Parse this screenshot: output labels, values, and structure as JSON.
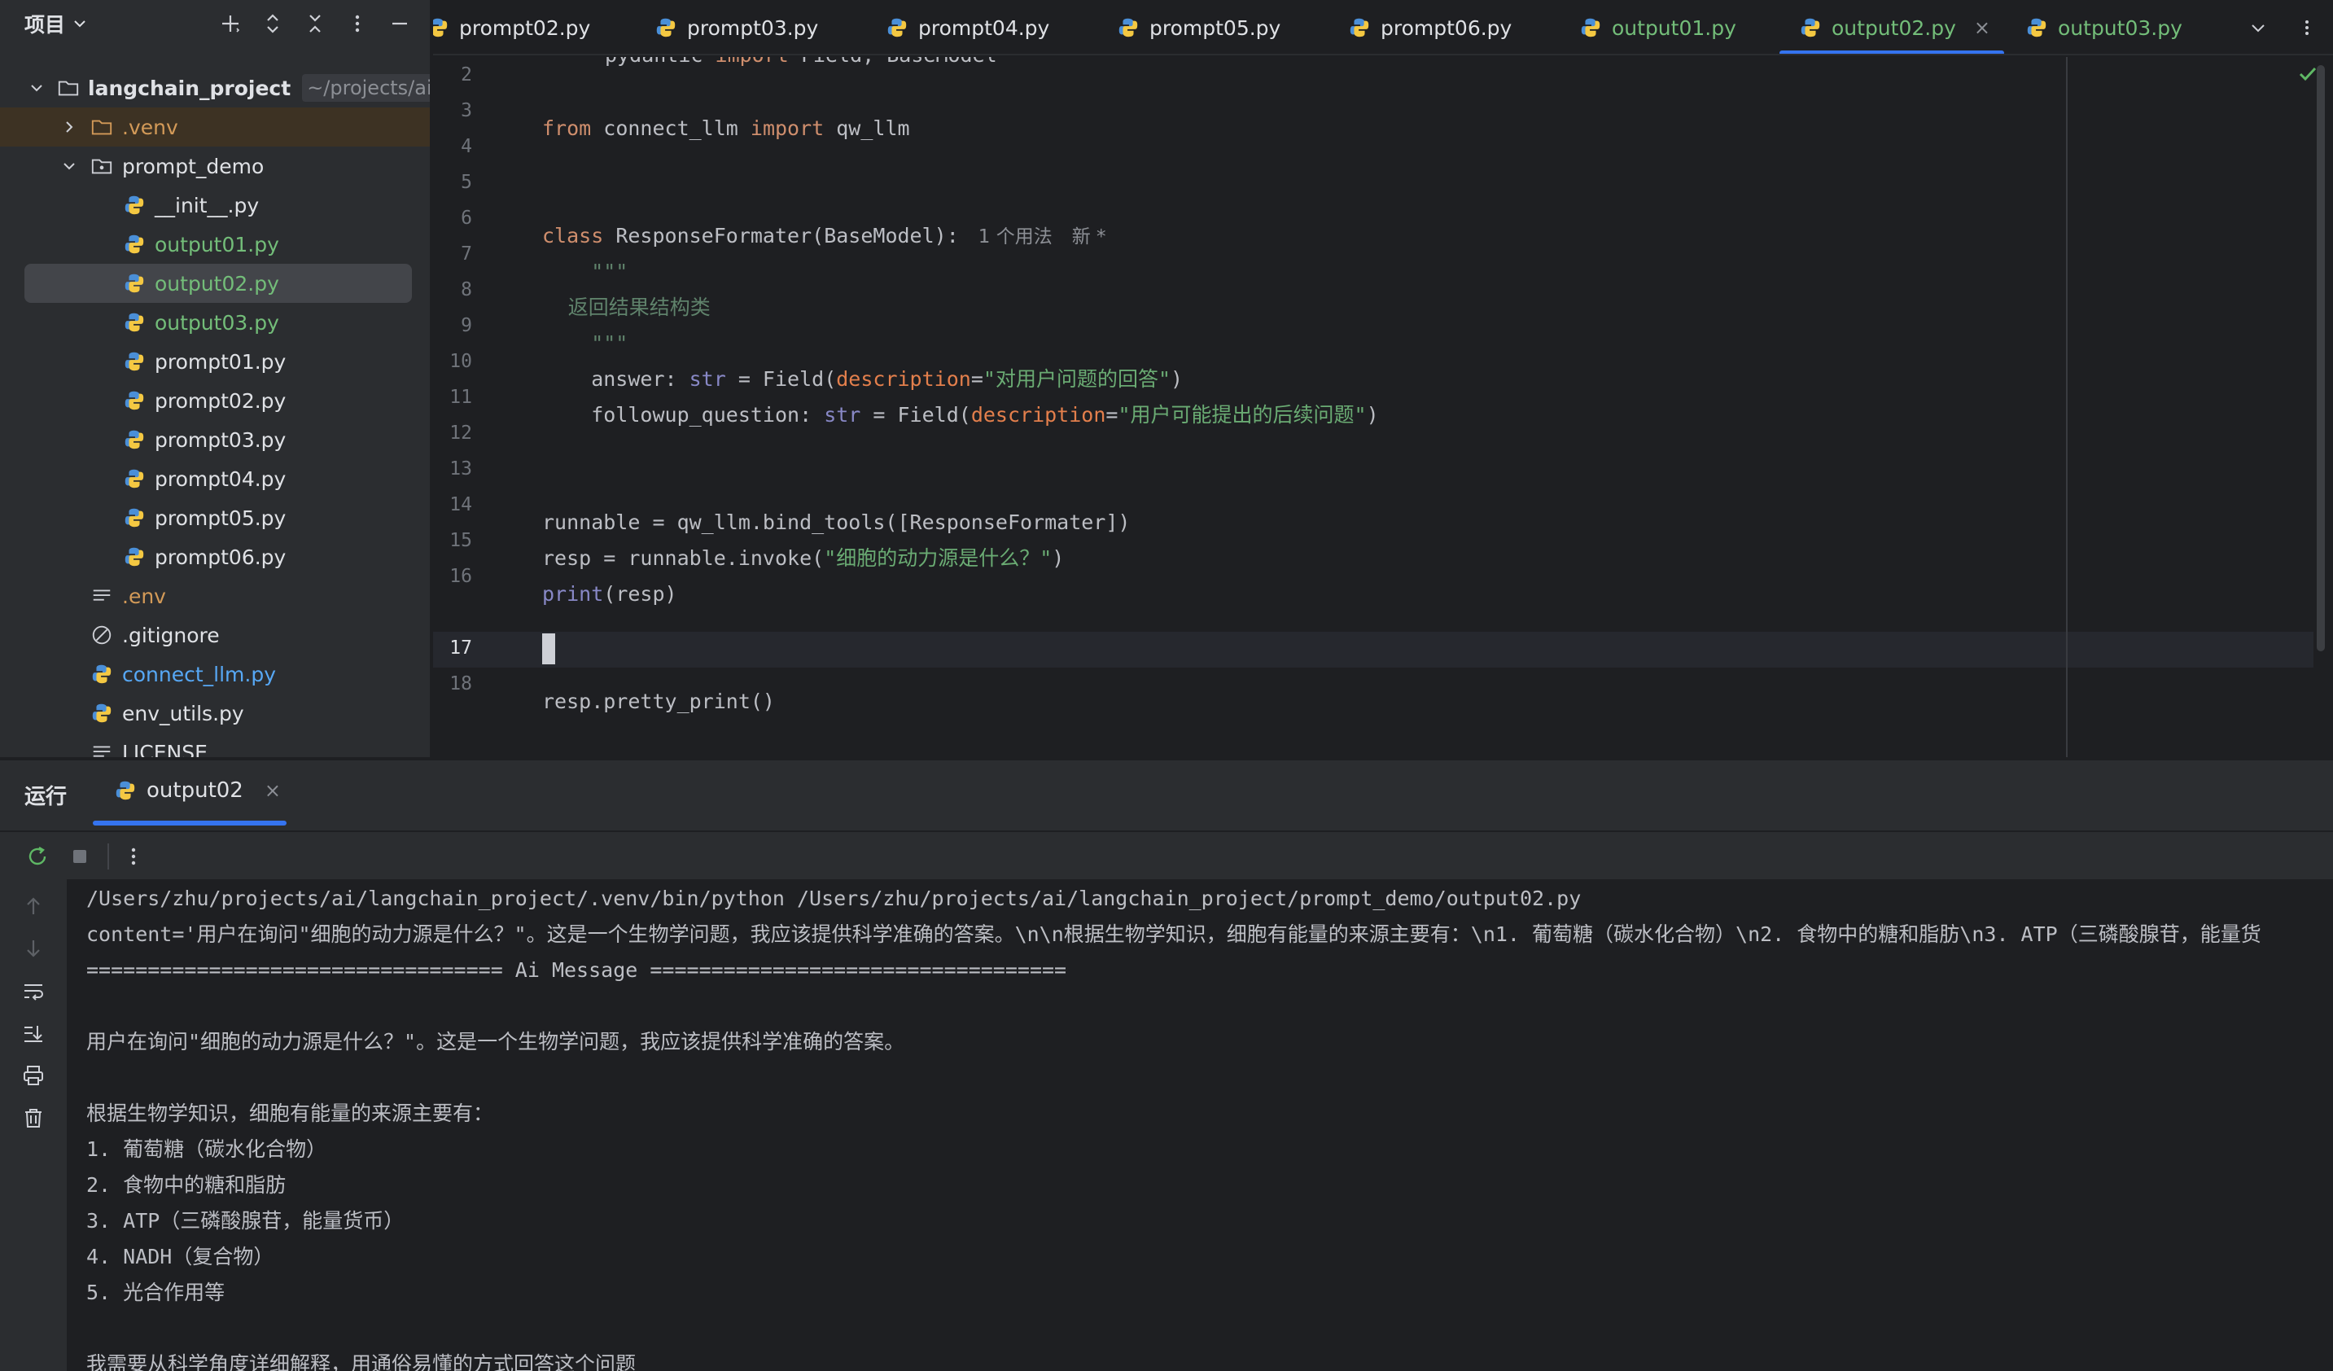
{
  "sidebar": {
    "title": "项目",
    "root": {
      "label": "langchain_project",
      "path_hint": "~/projects/ai/langchain_project"
    },
    "items": [
      {
        "label": ".venv"
      },
      {
        "label": "prompt_demo"
      },
      {
        "label": "__init__.py"
      },
      {
        "label": "output01.py"
      },
      {
        "label": "output02.py"
      },
      {
        "label": "output03.py"
      },
      {
        "label": "prompt01.py"
      },
      {
        "label": "prompt02.py"
      },
      {
        "label": "prompt03.py"
      },
      {
        "label": "prompt04.py"
      },
      {
        "label": "prompt05.py"
      },
      {
        "label": "prompt06.py"
      },
      {
        "label": ".env"
      },
      {
        "label": ".gitignore"
      },
      {
        "label": "connect_llm.py"
      },
      {
        "label": "env_utils.py"
      },
      {
        "label": "LICENSE"
      }
    ]
  },
  "tabs": [
    {
      "label": "prompt02.py"
    },
    {
      "label": "prompt03.py"
    },
    {
      "label": "prompt04.py"
    },
    {
      "label": "prompt05.py"
    },
    {
      "label": "prompt06.py"
    },
    {
      "label": "output01.py"
    },
    {
      "label": "output02.py",
      "close": "×"
    },
    {
      "label": "output03.py"
    }
  ],
  "editor": {
    "line_numbers": [
      "2",
      "3",
      "4",
      "5",
      "6",
      "7",
      "8",
      "9",
      "10",
      "11",
      "12",
      "13",
      "14",
      "15",
      "16",
      "17",
      "18"
    ],
    "code": {
      "l1_tail": " pydantic ",
      "l1_kw": "import",
      "l1_rest": " Field, BaseModel",
      "l3_from": "from",
      "l3_mod": " connect_llm ",
      "l3_import": "import",
      "l3_rest": " qw_llm",
      "l6_kw": "class",
      "l6_rest": " ResponseFormater(BaseModel):",
      "l6_hint1": "1 个用法",
      "l6_hint2": "新 *",
      "l7": "    \"\"\"",
      "l8": "    返回结果结构类",
      "l9": "    \"\"\"",
      "l10_a": "    answer: ",
      "l10_type": "str",
      "l10_b": " = Field(",
      "l10_param": "description",
      "l10_eq": "=",
      "l10_str": "\"对用户问题的回答\"",
      "l10_end": ")",
      "l11_a": "    followup_question: ",
      "l11_type": "str",
      "l11_b": " = Field(",
      "l11_param": "description",
      "l11_eq": "=",
      "l11_str": "\"用户可能提出的后续问题\"",
      "l11_end": ")",
      "l14": "runnable = qw_llm.bind_tools([ResponseFormater])",
      "l15_a": "resp = runnable.invoke(",
      "l15_str": "\"细胞的动力源是什么？\"",
      "l15_end": ")",
      "l16_fn": "print",
      "l16_rest": "(resp)",
      "l18": "resp.pretty_print()"
    }
  },
  "run": {
    "title": "运行",
    "tab_label": "output02",
    "tab_close": "×",
    "output": [
      "/Users/zhu/projects/ai/langchain_project/.venv/bin/python /Users/zhu/projects/ai/langchain_project/prompt_demo/output02.py",
      "content='用户在询问\"细胞的动力源是什么？\"。这是一个生物学问题，我应该提供科学准确的答案。\\n\\n根据生物学知识，细胞有能量的来源主要有：\\n1. 葡萄糖（碳水化合物）\\n2. 食物中的糖和脂肪\\n3. ATP（三磷酸腺苷，能量货",
      "================================== Ai Message ==================================",
      "",
      "用户在询问\"细胞的动力源是什么？\"。这是一个生物学问题，我应该提供科学准确的答案。",
      "",
      "根据生物学知识，细胞有能量的来源主要有：",
      "1. 葡萄糖（碳水化合物）",
      "2. 食物中的糖和脂肪",
      "3. ATP（三磷酸腺苷，能量货币）",
      "4. NADH（复合物）",
      "5. 光合作用等",
      "",
      "我需要从科学角度详细解释，用通俗易懂的方式回答这个问题"
    ]
  },
  "colors": {
    "accent": "#3574f0",
    "vcs_added": "#73bd79",
    "ignored": "#d39a58",
    "modified": "#57a8f5"
  }
}
